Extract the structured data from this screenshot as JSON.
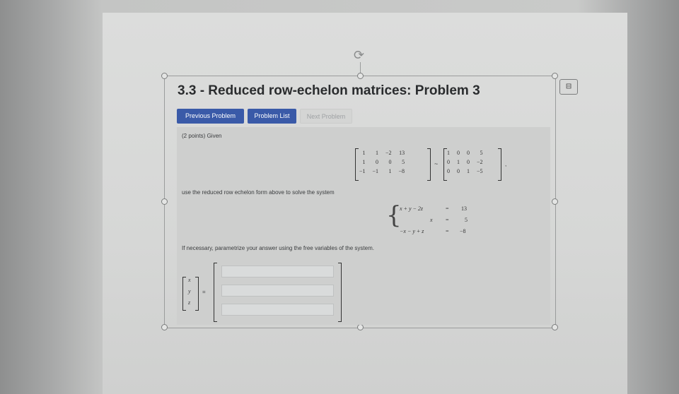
{
  "problem": {
    "title": "3.3 - Reduced row-echelon matrices: Problem 3",
    "points_text": "(2 points) Given",
    "instruction": "use the reduced row echelon form above to solve the system",
    "parametrize_text": "If necessary, parametrize your answer using the free variables of the system.",
    "tilde": "~",
    "comma": ","
  },
  "nav": {
    "previous": "Previous Problem",
    "list": "Problem List",
    "next": "Next Problem"
  },
  "matrix_a": [
    [
      "1",
      "1",
      "−2",
      "13"
    ],
    [
      "1",
      "0",
      "0",
      "5"
    ],
    [
      "−1",
      "−1",
      "1",
      "−8"
    ]
  ],
  "matrix_b": [
    [
      "1",
      "0",
      "0",
      "5"
    ],
    [
      "0",
      "1",
      "0",
      "−2"
    ],
    [
      "0",
      "0",
      "1",
      "−5"
    ]
  ],
  "system": [
    {
      "lhs": "x + y − 2z",
      "eq": "=",
      "rhs": "13"
    },
    {
      "lhs": "x",
      "eq": "=",
      "rhs": "5"
    },
    {
      "lhs": "−x − y + z",
      "eq": "=",
      "rhs": "−8"
    }
  ],
  "answer": {
    "vars": [
      "x",
      "y",
      "z"
    ],
    "equals": "=",
    "fields": [
      "",
      "",
      ""
    ]
  },
  "toolbar": {
    "layout_icon": "layout-options-icon"
  },
  "colors": {
    "button_blue": "#3a5aa8",
    "disabled_text": "#9fa2a4"
  }
}
